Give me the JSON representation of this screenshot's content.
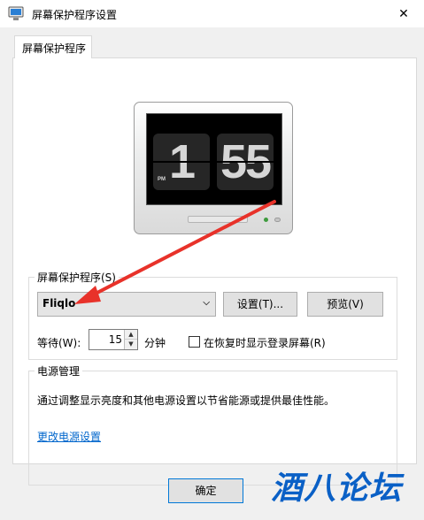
{
  "window": {
    "title": "屏幕保护程序设置",
    "close_glyph": "✕"
  },
  "tab": {
    "label": "屏幕保护程序"
  },
  "preview": {
    "hour": "1",
    "minute": "55",
    "ampm": "PM"
  },
  "screensaver_group": {
    "label": "屏幕保护程序(S)",
    "selected": "Fliqlo",
    "settings_button": "设置(T)...",
    "preview_button": "预览(V)",
    "wait_label": "等待(W):",
    "wait_value": "15",
    "minutes_label": "分钟",
    "resume_checkbox_label": "在恢复时显示登录屏幕(R)",
    "resume_checked": false
  },
  "power_group": {
    "label": "电源管理",
    "description": "通过调整显示亮度和其他电源设置以节省能源或提供最佳性能。",
    "link": "更改电源设置"
  },
  "footer": {
    "ok_button": "确定"
  },
  "watermark": {
    "text": "酒八论坛"
  },
  "colors": {
    "annotation_arrow": "#e8322a",
    "link": "#0066cc",
    "watermark": "#0a60c6"
  }
}
